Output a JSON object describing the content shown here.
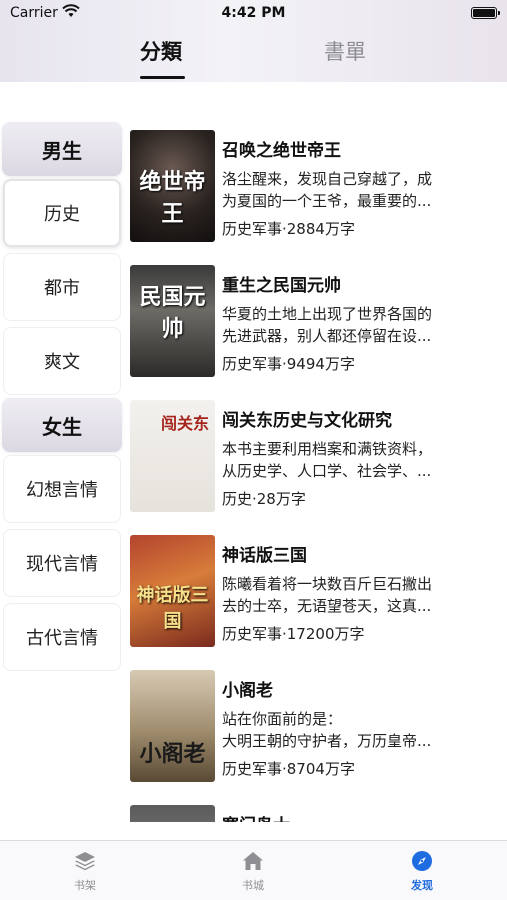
{
  "status_bar": {
    "carrier": "Carrier",
    "time": "4:42 PM"
  },
  "top_tabs": [
    {
      "label": "分類",
      "active": true
    },
    {
      "label": "書單",
      "active": false
    }
  ],
  "sidebar": {
    "groups": [
      {
        "header": "男生",
        "items": [
          "历史",
          "都市",
          "爽文"
        ]
      },
      {
        "header": "女生",
        "items": [
          "幻想言情",
          "现代言情",
          "古代言情"
        ]
      }
    ],
    "selected": "历史"
  },
  "books": [
    {
      "title": "召唤之绝世帝王",
      "desc1": "洛尘醒来，发现自己穿越了，成",
      "desc2": "为夏国的一个王爷，最重要的...",
      "meta": "历史军事·2884万字",
      "cover_text": "绝世帝王"
    },
    {
      "title": "重生之民国元帅",
      "desc1": "华夏的土地上出现了世界各国的",
      "desc2": "先进武器，别人都还停留在设...",
      "meta": "历史军事·9494万字",
      "cover_text": "民国元帅"
    },
    {
      "title": "闯关东历史与文化研究",
      "desc1": "本书主要利用档案和满铁资料，",
      "desc2": "从历史学、人口学、社会学、...",
      "meta": "历史·28万字",
      "cover_text": "闯关东"
    },
    {
      "title": "神话版三国",
      "desc1": "陈曦看着将一块数百斤巨石撇出",
      "desc2": "去的士卒，无语望苍天，这真...",
      "meta": "历史军事·17200万字",
      "cover_text": "神话版三国"
    },
    {
      "title": "小阁老",
      "desc1": "站在你面前的是：",
      "desc2": "大明王朝的守护者，万历皇帝...",
      "meta": "历史军事·8704万字",
      "cover_text": "小阁老"
    },
    {
      "title": "寒门枭士",
      "desc1": "",
      "desc2": "",
      "meta": "",
      "cover_text": ""
    }
  ],
  "tabbar": [
    {
      "label": "书架",
      "icon": "stack-icon",
      "active": false
    },
    {
      "label": "书城",
      "icon": "home-icon",
      "active": false
    },
    {
      "label": "发现",
      "icon": "compass-icon",
      "active": true
    }
  ],
  "colors": {
    "accent": "#1f6be0",
    "inactive": "#8e8e93"
  }
}
